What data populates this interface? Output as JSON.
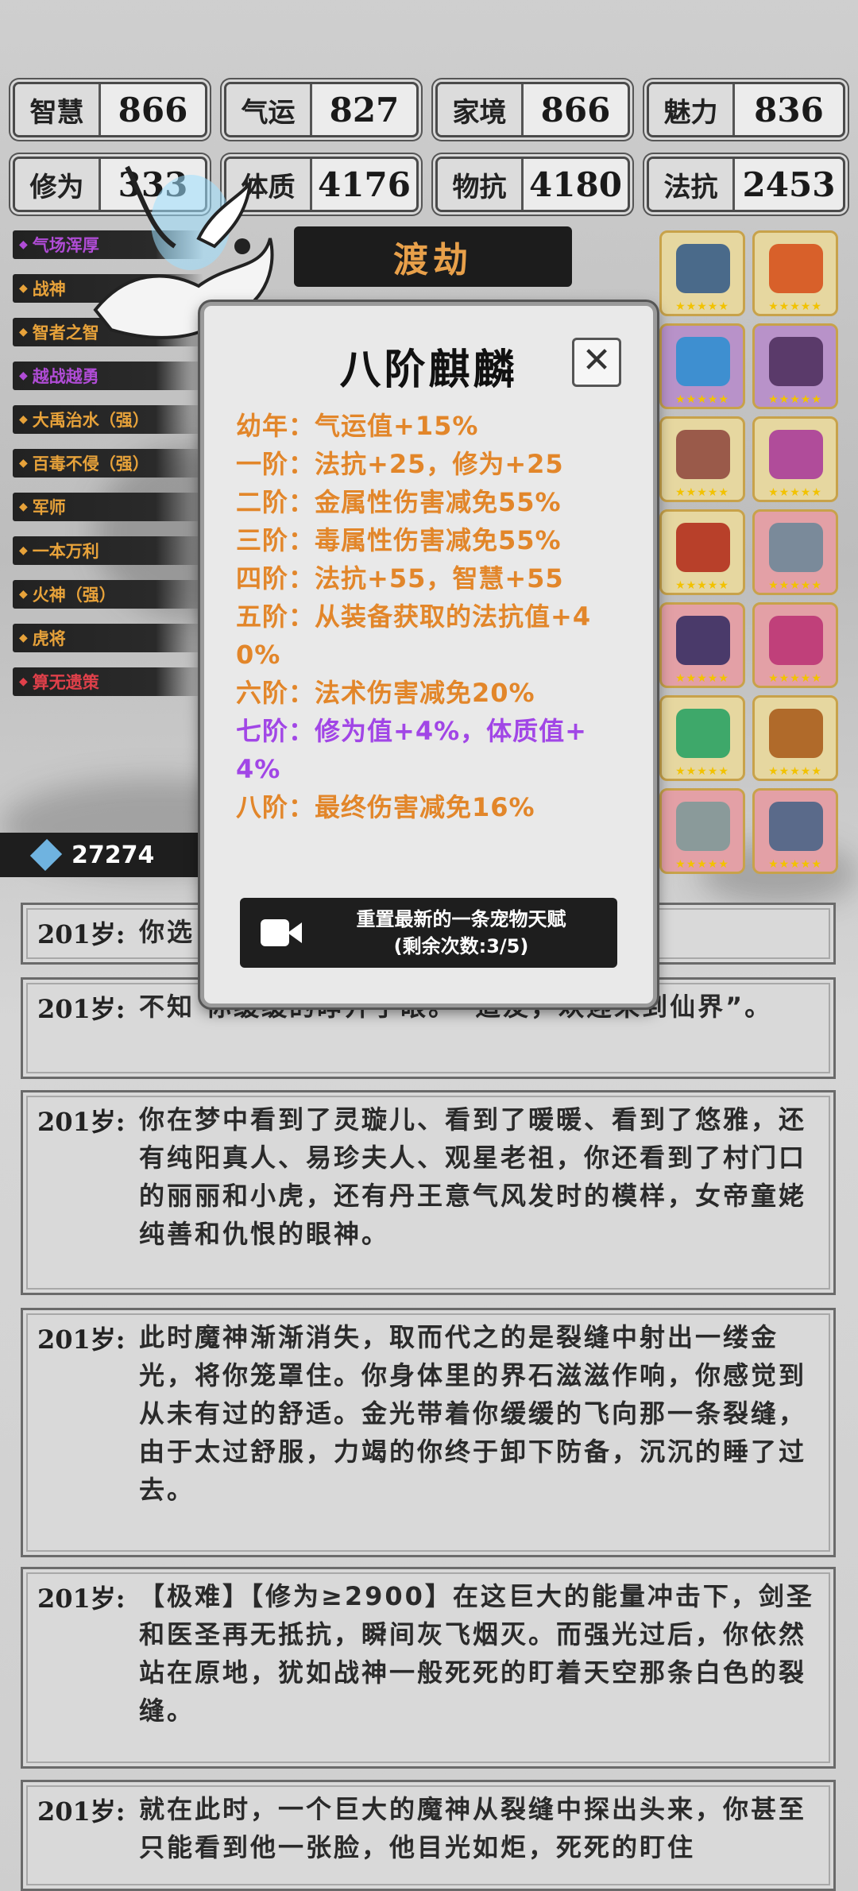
{
  "stats": [
    {
      "label": "智慧",
      "value": "866"
    },
    {
      "label": "气运",
      "value": "827"
    },
    {
      "label": "家境",
      "value": "866"
    },
    {
      "label": "魅力",
      "value": "836"
    },
    {
      "label": "修为",
      "value": "333"
    },
    {
      "label": "体质",
      "value": "4176"
    },
    {
      "label": "物抗",
      "value": "4180"
    },
    {
      "label": "法抗",
      "value": "2453"
    }
  ],
  "talents": [
    {
      "label": "气场浑厚",
      "color": "#b04cd6"
    },
    {
      "label": "战神",
      "color": "#e7a23a"
    },
    {
      "label": "智者之智",
      "color": "#e7a23a"
    },
    {
      "label": "越战越勇",
      "color": "#b04cd6"
    },
    {
      "label": "大禹治水（强）",
      "color": "#e7a23a"
    },
    {
      "label": "百毒不侵（强）",
      "color": "#e7a23a"
    },
    {
      "label": "军师",
      "color": "#e7a23a"
    },
    {
      "label": "一本万利",
      "color": "#e7a23a"
    },
    {
      "label": "火神（强）",
      "color": "#e7a23a"
    },
    {
      "label": "虎将",
      "color": "#e7a23a"
    },
    {
      "label": "算无遗策",
      "color": "#e0404a"
    }
  ],
  "banner": {
    "label": "渡劫"
  },
  "currency": {
    "amount": "27274"
  },
  "modal": {
    "title": "八阶麒麟",
    "rows": [
      {
        "text": "幼年：气运值+15%",
        "color": "orange"
      },
      {
        "text": "一阶：法抗+25，修为+25",
        "color": "orange"
      },
      {
        "text": "二阶：金属性伤害减免55%",
        "color": "orange"
      },
      {
        "text": "三阶：毒属性伤害减免55%",
        "color": "orange"
      },
      {
        "text": "四阶：法抗+55，智慧+55",
        "color": "orange"
      },
      {
        "text": "五阶：从装备获取的法抗值+40%",
        "color": "orange"
      },
      {
        "text": "六阶：法术伤害减免20%",
        "color": "orange"
      },
      {
        "text": "七阶：修为值+4%，体质值+4%",
        "color": "purple"
      },
      {
        "text": "八阶：最终伤害减免16%",
        "color": "orange"
      }
    ],
    "button": {
      "line1": "重置最新的一条宠物天赋",
      "line2": "(剩余次数:3/5)"
    }
  },
  "equipment": [
    {
      "icon": "dagger-icon",
      "bg": "y",
      "color": "#4a6a8a"
    },
    {
      "icon": "bracelet-icon",
      "bg": "y",
      "color": "#d8602a"
    },
    {
      "icon": "orb-icon",
      "bg": "p",
      "color": "#3e8fd0"
    },
    {
      "icon": "bow-icon",
      "bg": "p",
      "color": "#5a3a6a"
    },
    {
      "icon": "scroll-icon",
      "bg": "y",
      "color": "#9a5a4a"
    },
    {
      "icon": "teapot-icon",
      "bg": "y",
      "color": "#b04c9a"
    },
    {
      "icon": "boots-icon",
      "bg": "y",
      "color": "#b8402a"
    },
    {
      "icon": "sword-icon",
      "bg": "r",
      "color": "#7a8a9a"
    },
    {
      "icon": "ring-icon",
      "bg": "r",
      "color": "#4a3a6a"
    },
    {
      "icon": "saddle-icon",
      "bg": "r",
      "color": "#c0407a"
    },
    {
      "icon": "crystal-icon",
      "bg": "y",
      "color": "#3ea86a"
    },
    {
      "icon": "fan-icon",
      "bg": "y",
      "color": "#b06a2a"
    },
    {
      "icon": "axe-icon",
      "bg": "r",
      "color": "#8a9a9a"
    },
    {
      "icon": "spear-icon",
      "bg": "r",
      "color": "#5a6a8a"
    }
  ],
  "logs": [
    {
      "age": "201岁:",
      "text": "你选"
    },
    {
      "age": "201岁:",
      "text": "不知                    你缓缓的睁开了眼。“道友，欢迎来到仙界”。"
    },
    {
      "age": "201岁:",
      "text": "你在梦中看到了灵璇儿、看到了暖暖、看到了悠雅，还有纯阳真人、易珍夫人、观星老祖，你还看到了村门口的丽丽和小虎，还有丹王意气风发时的模样，女帝童姥纯善和仇恨的眼神。"
    },
    {
      "age": "201岁:",
      "text": "此时魔神渐渐消失，取而代之的是裂缝中射出一缕金光，将你笼罩住。你身体里的界石滋滋作响，你感觉到从未有过的舒适。金光带着你缓缓的飞向那一条裂缝，由于太过舒服，力竭的你终于卸下防备，沉沉的睡了过去。"
    },
    {
      "age": "201岁:",
      "text": "【极难】【修为≥2900】在这巨大的能量冲击下，剑圣和医圣再无抵抗，瞬间灰飞烟灭。而强光过后，你依然站在原地，犹如战神一般死死的盯着天空那条白色的裂缝。"
    },
    {
      "age": "201岁:",
      "text": "就在此时，一个巨大的魔神从裂缝中探出头来，你甚至只能看到他一张脸，他目光如炬，死死的盯住"
    }
  ]
}
